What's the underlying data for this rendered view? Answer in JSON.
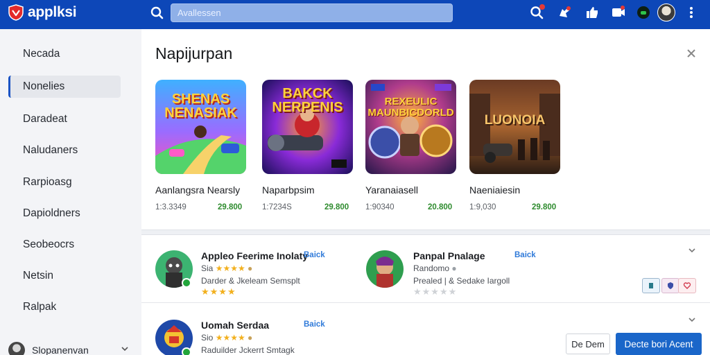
{
  "header": {
    "logo_text": "applksi",
    "search_placeholder": "Avallessen",
    "icons": [
      "search-icon",
      "camera-icon",
      "thumbs-up-icon",
      "video-icon",
      "game-controller-icon",
      "avatar",
      "more-vert-icon"
    ]
  },
  "sidebar": {
    "items": [
      {
        "label": "Necada",
        "active": false
      },
      {
        "label": "Nonelies",
        "active": true
      },
      {
        "label": "Daradeat",
        "active": false
      },
      {
        "label": "Naludaners",
        "active": false
      },
      {
        "label": "Rarpioasg",
        "active": false
      },
      {
        "label": "Dapioldners",
        "active": false
      },
      {
        "label": "Seobeocrs",
        "active": false
      },
      {
        "label": "Netsin",
        "active": false
      },
      {
        "label": "Ralpak",
        "active": false
      }
    ],
    "footer": {
      "label": "Slopanenvan"
    }
  },
  "panel": {
    "title": "Napijurpan",
    "games": [
      {
        "thumb_text": "SHENAS NENASIAK",
        "name": "Aanlangsra Nearsly",
        "downloads": "1:3.3349",
        "price": "29.800"
      },
      {
        "thumb_text": "BAKCK NERPENIS",
        "name": "Naparbpsim",
        "downloads": "1:7234S",
        "price": "29.800"
      },
      {
        "thumb_text": "REXEULIC MAUNBICDORLD",
        "name": "Yaranaiasell",
        "downloads": "1:90340",
        "price": "20.800"
      },
      {
        "thumb_text": "LUONOIA",
        "name": "Naeniaiesin",
        "downloads": "1:9,030",
        "price": "29.800"
      }
    ]
  },
  "list": {
    "items": [
      {
        "name": "Appleo Feerime Inolaty",
        "tag": "Baick",
        "sub": "Sia",
        "desc": "Darder & Jkeleam Semsplt",
        "rating": 4
      },
      {
        "name": "Panpal Pnalage",
        "tag": "Baick",
        "sub": "Randomo",
        "desc": "Prealed | & Sedake Iargoll",
        "rating": 0
      },
      {
        "name": "Uomah Serdaa",
        "tag": "Baick",
        "sub": "Sio",
        "desc": "Raduilder Jckerrt Smtagk",
        "rating": 4
      }
    ],
    "buttons": {
      "secondary": "De Dem",
      "primary": "Decte bori Acent"
    }
  },
  "colors": {
    "header_bg": "#0d47b8",
    "accent": "#1a66c9",
    "price": "#2e8b2e",
    "star": "#f2b01e"
  }
}
